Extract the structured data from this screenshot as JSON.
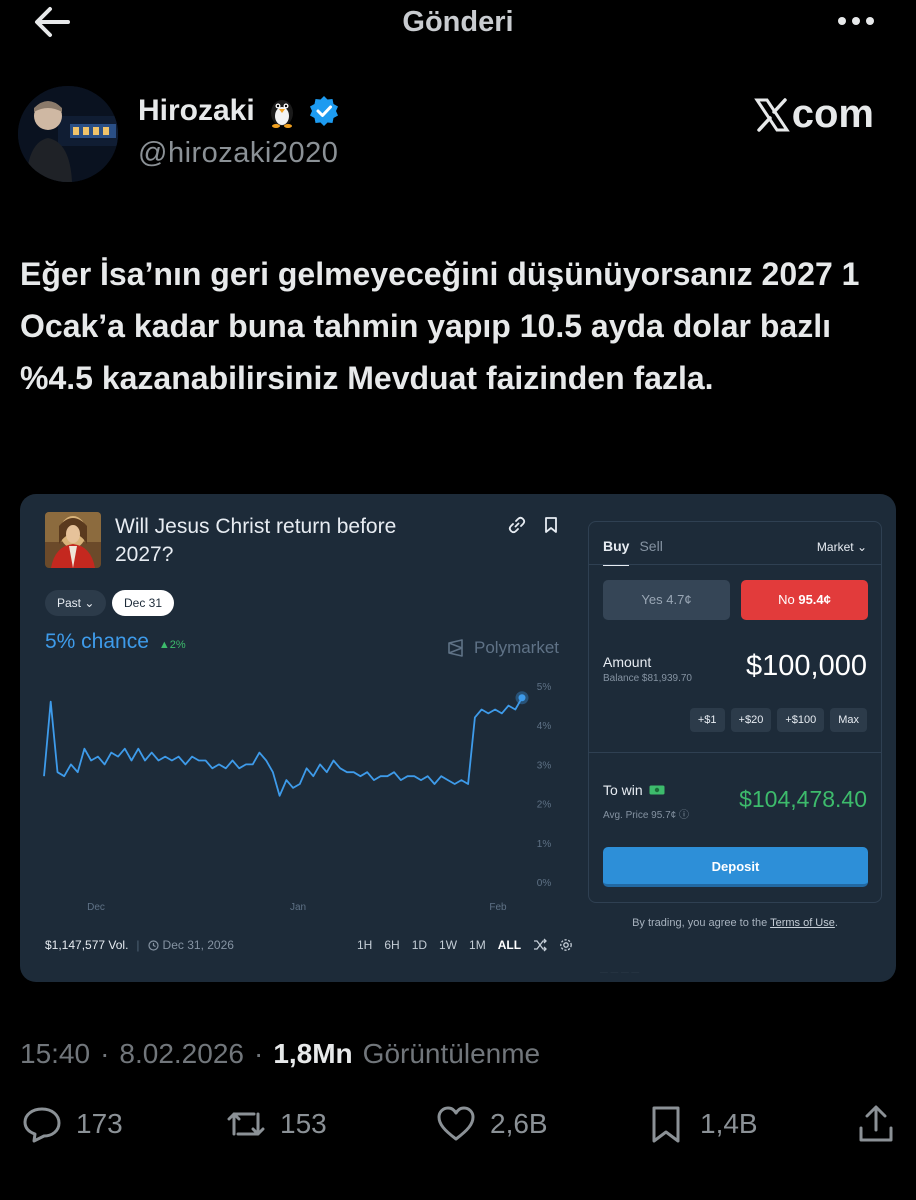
{
  "header": {
    "title": "Gönderi",
    "back_icon": "arrow-left-icon",
    "more_icon": "more-horizontal-icon"
  },
  "author": {
    "name": "Hirozaki",
    "handle": "@hirozaki2020",
    "verified": true,
    "emoji": "penguin"
  },
  "watermark": "com",
  "tweet": {
    "text": "Eğer İsa’nın geri gelmeyeceğini düşünüyorsanız 2027 1 Ocak’a kadar buna tahmin yapıp 10.5 ayda dolar bazlı %4.5 kazanabilirsiniz Mevduat faizinden fazla."
  },
  "card": {
    "question": "Will Jesus Christ return before 2027?",
    "filter_past": "Past",
    "filter_date": "Dec 31",
    "chance": "5% chance",
    "chance_delta": "▲2%",
    "brand": "Polymarket",
    "volume": "$1,147,577 Vol.",
    "end_date": "Dec 31, 2026",
    "ranges": [
      "1H",
      "6H",
      "1D",
      "1W",
      "1M",
      "ALL"
    ],
    "trade": {
      "tab_buy": "Buy",
      "tab_sell": "Sell",
      "order_type": "Market",
      "yes_label": "Yes",
      "yes_price": "4.7¢",
      "no_label": "No",
      "no_price": "95.4¢",
      "amount_label": "Amount",
      "balance": "Balance $81,939.70",
      "amount_value": "$100,000",
      "chips": [
        "+$1",
        "+$20",
        "+$100",
        "Max"
      ],
      "to_win_label": "To win",
      "avg_price": "Avg. Price 95.7¢",
      "payout": "$104,478.40",
      "deposit_label": "Deposit"
    },
    "terms_prefix": "By trading, you agree to the",
    "terms_link": "Terms of Use",
    "terms_suffix": "."
  },
  "chart_data": {
    "type": "line",
    "y_unit": "%",
    "ylim": [
      0,
      5
    ],
    "yticks": [
      "5%",
      "4%",
      "3%",
      "2%",
      "1%",
      "0%"
    ],
    "xticks": [
      "Dec",
      "Jan",
      "Feb"
    ],
    "grid": false,
    "series": [
      {
        "color": "#3e9bea",
        "values": [
          2.7,
          4.6,
          2.8,
          2.7,
          3.0,
          2.8,
          3.4,
          3.1,
          3.2,
          3.0,
          3.3,
          3.2,
          3.4,
          3.1,
          3.4,
          3.1,
          3.3,
          3.1,
          3.2,
          3.1,
          3.2,
          3.0,
          3.2,
          3.1,
          3.1,
          2.9,
          3.0,
          2.9,
          3.1,
          2.9,
          3.0,
          3.0,
          3.3,
          3.1,
          2.8,
          2.2,
          2.6,
          2.4,
          2.5,
          2.9,
          2.7,
          3.0,
          2.8,
          3.1,
          2.9,
          2.8,
          2.8,
          2.7,
          2.8,
          2.6,
          2.7,
          2.7,
          2.8,
          2.6,
          2.7,
          2.7,
          2.6,
          2.7,
          2.5,
          2.7,
          2.6,
          2.5,
          2.6,
          2.5,
          4.2,
          4.4,
          4.3,
          4.4,
          4.3,
          4.5,
          4.4,
          4.7
        ]
      }
    ]
  },
  "footer": {
    "time": "15:40",
    "date": "8.02.2026",
    "views_count": "1,8Mn",
    "views_label": "Görüntülenme",
    "replies": "173",
    "reposts": "153",
    "likes": "2,6B",
    "bookmarks": "1,4B"
  }
}
